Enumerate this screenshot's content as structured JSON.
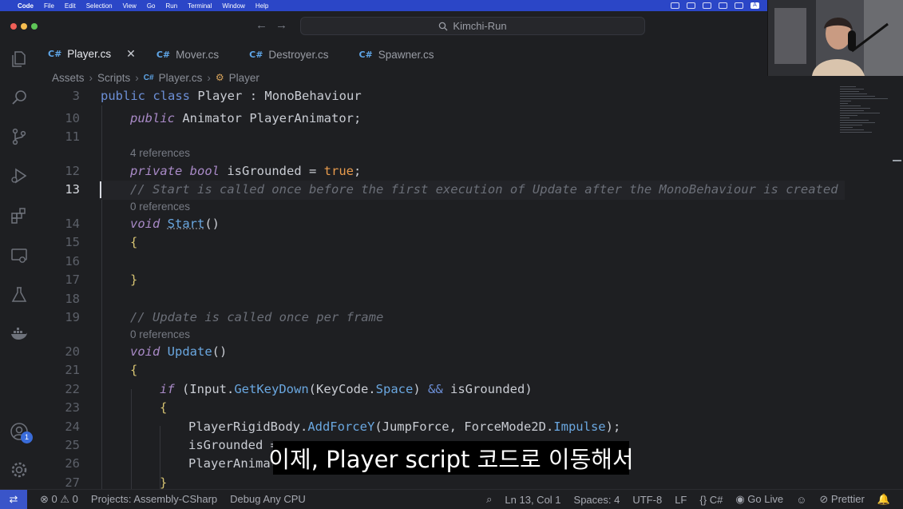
{
  "menubar": {
    "items": [
      "Code",
      "File",
      "Edit",
      "Selection",
      "View",
      "Go",
      "Run",
      "Terminal",
      "Window",
      "Help"
    ]
  },
  "titlebar": {
    "search_text": "Kimchi-Run",
    "back_label": "←",
    "forward_label": "→"
  },
  "tabs": [
    {
      "label": "Player.cs",
      "active": true,
      "close": "✕"
    },
    {
      "label": "Mover.cs",
      "active": false
    },
    {
      "label": "Destroyer.cs",
      "active": false
    },
    {
      "label": "Spawner.cs",
      "active": false
    }
  ],
  "breadcrumb": [
    "Assets",
    "Scripts",
    "Player.cs",
    "Player"
  ],
  "code_lines": [
    {
      "num": "3",
      "text": "public class Player : MonoBehaviour"
    },
    {
      "num": "10",
      "text": "public Animator PlayerAnimator;"
    },
    {
      "num": "11",
      "text": ""
    },
    {
      "lens": "4 references"
    },
    {
      "num": "12",
      "text": "private bool isGrounded = true;"
    },
    {
      "num": "13",
      "text": "// Start is called once before the first execution of Update after the MonoBehaviour is created"
    },
    {
      "lens": "0 references"
    },
    {
      "num": "14",
      "text": "void Start()"
    },
    {
      "num": "15",
      "text": "{"
    },
    {
      "num": "16",
      "text": ""
    },
    {
      "num": "17",
      "text": "}"
    },
    {
      "num": "18",
      "text": ""
    },
    {
      "num": "19",
      "text": "// Update is called once per frame"
    },
    {
      "lens": "0 references"
    },
    {
      "num": "20",
      "text": "void Update()"
    },
    {
      "num": "21",
      "text": "{"
    },
    {
      "num": "22",
      "text": "if (Input.GetKeyDown(KeyCode.Space) && isGrounded)"
    },
    {
      "num": "23",
      "text": "{"
    },
    {
      "num": "24",
      "text": "PlayerRigidBody.AddForceY(JumpForce, ForceMode2D.Impulse);"
    },
    {
      "num": "25",
      "text": "isGrounded = "
    },
    {
      "num": "26",
      "text": "PlayerAnimat"
    },
    {
      "num": "27",
      "text": "}"
    }
  ],
  "caption": "이제, Player script 코드로 이동해서",
  "statusbar": {
    "errors": "0",
    "warnings": "0",
    "project": "Projects: Assembly-CSharp",
    "debug": "Debug Any CPU",
    "position": "Ln 13, Col 1",
    "spaces": "Spaces: 4",
    "encoding": "UTF-8",
    "eol": "LF",
    "language": "C#",
    "golive": "Go Live",
    "prettier": "Prettier"
  },
  "activity_badge": "1",
  "colors": {
    "accent": "#3a55c9",
    "keyword": "#6c8fd6",
    "function": "#6aa7e0",
    "literal": "#e89b4d",
    "comment": "#6b6f78"
  }
}
